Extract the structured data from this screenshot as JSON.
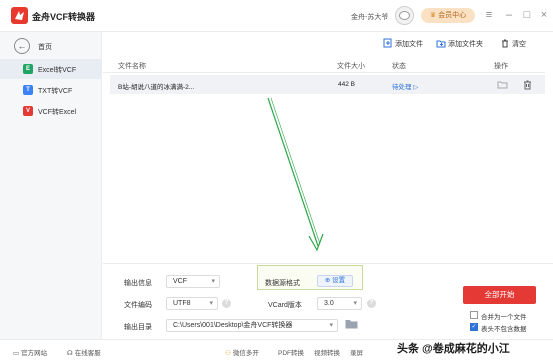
{
  "app": {
    "title": "金舟VCF转换器",
    "user_name": "金舟-苏大爷",
    "vip_label": "会员中心"
  },
  "sidebar": {
    "home_label": "首页",
    "items": [
      {
        "badge": "E",
        "label": "Excel转VCF",
        "color": "#1fa463",
        "active": true
      },
      {
        "badge": "T",
        "label": "TXT转VCF",
        "color": "#3b82f6",
        "active": false
      },
      {
        "badge": "V",
        "label": "VCF转Excel",
        "color": "#e53935",
        "active": false
      }
    ]
  },
  "toolbar": {
    "add_file": "添加文件",
    "add_folder": "添加文件夹",
    "clear": "清空"
  },
  "table": {
    "headers": [
      "文件名称",
      "文件大小",
      "状态",
      "操作"
    ],
    "rows": [
      {
        "name": "B站-胡说八道的冰满满-2...",
        "size": "442 B",
        "status": "待处理"
      }
    ]
  },
  "settings": {
    "output_type_label": "输出信息",
    "output_type_value": "VCF",
    "encoding_label": "文件编码",
    "encoding_value": "UTF8",
    "source_format_label": "数据源格式",
    "settings_button": "设置",
    "vcard_label": "VCard版本",
    "vcard_value": "3.0",
    "output_dir_label": "输出目录",
    "output_dir_value": "C:\\Users\\001\\Desktop\\金舟VCF转换器",
    "help_symbol": "?"
  },
  "actions": {
    "start": "全部开始",
    "merge_label": "合并为一个文件",
    "merge_checked": false,
    "no_header_label": "表头不包含数据",
    "no_header_checked": true
  },
  "footer": {
    "website": "官方网站",
    "online_service": "在线客服",
    "wechat": "微信多开",
    "pdf": "PDF转换",
    "video": "视频转换",
    "record": "录屏"
  },
  "watermark": "头条 @卷成麻花的小江",
  "colors": {
    "accent": "#2f72d8",
    "brand_red": "#e53935",
    "arrow_green": "#2ea84a"
  }
}
